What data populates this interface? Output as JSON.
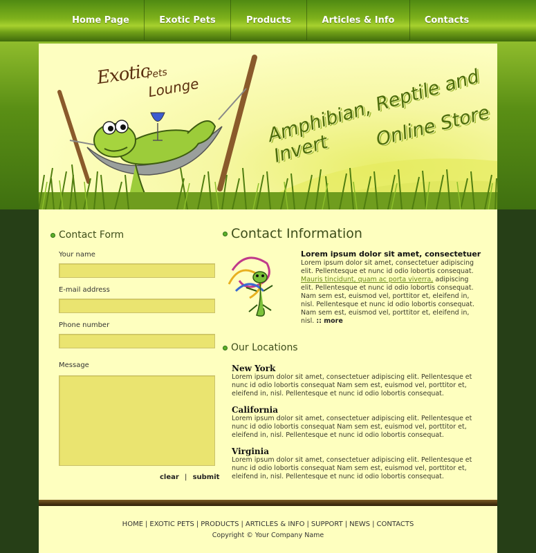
{
  "nav": {
    "items": [
      {
        "label": "Home Page"
      },
      {
        "label": "Exotic Pets"
      },
      {
        "label": "Products"
      },
      {
        "label": "Articles & Info"
      },
      {
        "label": "Contacts"
      }
    ]
  },
  "header": {
    "logo_line1": "Exotic",
    "logo_line2": "Pets",
    "logo_line3": "Lounge",
    "tagline1": "Amphibian, Reptile and Invert",
    "tagline2": "Online Store"
  },
  "contact_form": {
    "title": "Contact Form",
    "name_label": "Your name",
    "email_label": "E-mail address",
    "phone_label": "Phone number",
    "message_label": "Message",
    "clear_label": "clear",
    "separator": "|",
    "submit_label": "submit"
  },
  "contact_info": {
    "title": "Contact Information",
    "heading": "Lorem ipsum dolor sit amet, consectetuer",
    "text1": "Lorem ipsum dolor sit amet, consectetuer adipiscing elit. Pellentesque et nunc id odio lobortis consequat.",
    "link": "Mauris tincidunt, quam ac porta viverra,",
    "text2": "adipiscing elit. Pellentesque et nunc id odio lobortis consequat. Nam sem est, euismod vel, porttitor et, eleifend in, nisl. Pellentesque et nunc id odio lobortis consequat. Nam sem est, euismod vel, porttitor et, eleifend in, nisl.",
    "more": ":: more"
  },
  "locations": {
    "title": "Our Locations",
    "items": [
      {
        "name": "New York",
        "text": "Lorem ipsum dolor sit amet, consectetuer adipiscing elit. Pellentesque et nunc id odio lobortis consequat Nam sem est, euismod vel, porttitor et, eleifend in, nisl. Pellentesque et nunc id odio lobortis consequat."
      },
      {
        "name": "California",
        "text": "Lorem ipsum dolor sit amet, consectetuer adipiscing elit. Pellentesque et nunc id odio lobortis consequat Nam sem est, euismod vel, porttitor et, eleifend in, nisl. Pellentesque et nunc id odio lobortis consequat."
      },
      {
        "name": "Virginia",
        "text": "Lorem ipsum dolor sit amet, consectetuer adipiscing elit. Pellentesque et nunc id odio lobortis consequat Nam sem est, euismod vel, porttitor et, eleifend in, nisl. Pellentesque et nunc id odio lobortis consequat."
      }
    ]
  },
  "footer": {
    "links": [
      {
        "label": "HOME"
      },
      {
        "label": "EXOTIC PETS"
      },
      {
        "label": "PRODUCTS"
      },
      {
        "label": "ARTICLES & INFO"
      },
      {
        "label": "SUPPORT"
      },
      {
        "label": "NEWS"
      },
      {
        "label": "CONTACTS"
      }
    ],
    "separator": "|",
    "copyright": "Copyright © Your Company Name"
  },
  "colors": {
    "nav_green": "#7fb21c",
    "page_bg": "#feffbf",
    "dark_bg": "#263f17",
    "field_bg": "#eae470",
    "bullet": "#5cb02a"
  },
  "icons": [
    "frog-hammock-illustration",
    "lizard-ribbon-illustration",
    "bullet-icon"
  ]
}
